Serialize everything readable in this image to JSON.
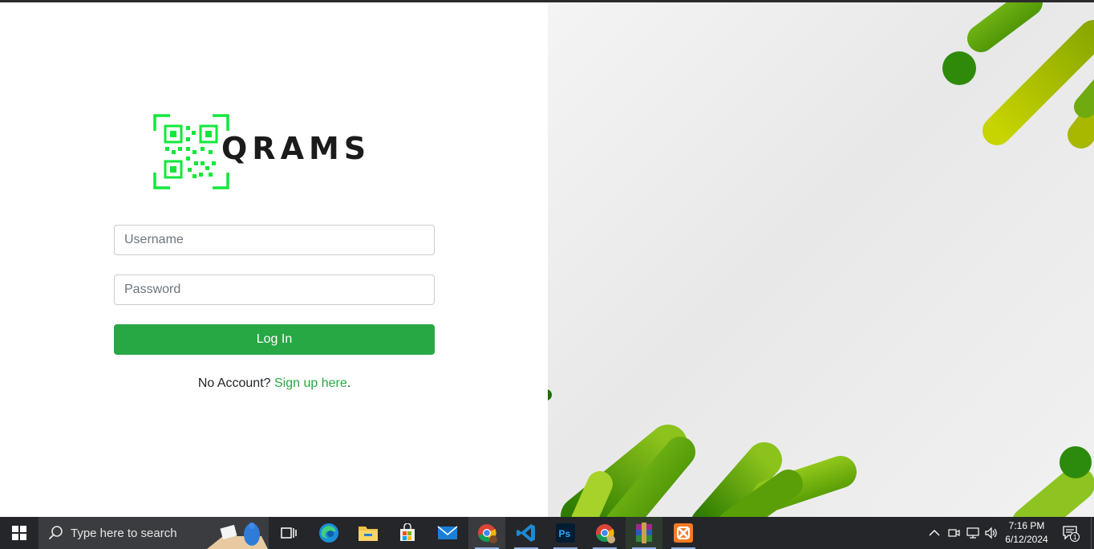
{
  "login": {
    "logo_text": "QRAMS",
    "username_placeholder": "Username",
    "password_placeholder": "Password",
    "login_label": "Log In",
    "signup_prompt": "No Account? ",
    "signup_link": "Sign up here",
    "signup_suffix": "."
  },
  "colors": {
    "accent": "#28a745",
    "logo_green": "#12e83a",
    "taskbar": "#25262a"
  },
  "taskbar": {
    "search_placeholder": "Type here to search",
    "apps": [
      "task-view",
      "edge",
      "file-explorer",
      "microsoft-store",
      "mail",
      "chrome",
      "vscode",
      "photoshop",
      "chrome-profile",
      "winrar",
      "xampp"
    ],
    "time": "7:16 PM",
    "date": "6/12/2024",
    "notification_count": "1"
  }
}
